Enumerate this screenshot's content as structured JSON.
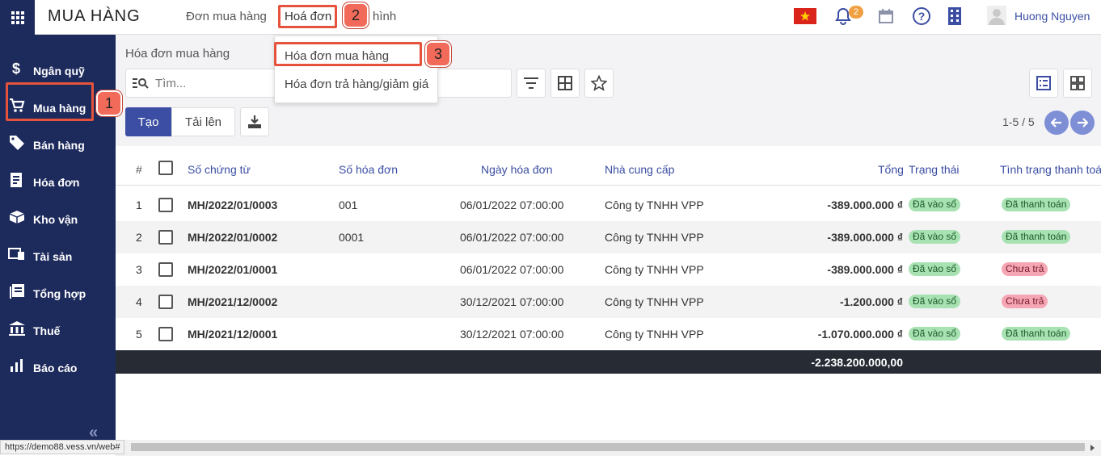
{
  "app": {
    "title": "MUA HÀNG"
  },
  "nav": {
    "purchase_orders": "Đơn mua hàng",
    "invoices": "Hoá đơn",
    "config": "hình"
  },
  "header": {
    "notification_count": "2",
    "user_name": "Huong Nguyen"
  },
  "sidebar": {
    "items": [
      {
        "label": "Ngân quỹ",
        "icon": "dollar-icon"
      },
      {
        "label": "Mua hàng",
        "icon": "cart-icon"
      },
      {
        "label": "Bán hàng",
        "icon": "tag-icon"
      },
      {
        "label": "Hóa đơn",
        "icon": "receipt-icon"
      },
      {
        "label": "Kho vận",
        "icon": "boxes-icon"
      },
      {
        "label": "Tài sản",
        "icon": "asset-icon"
      },
      {
        "label": "Tổng hợp",
        "icon": "book-icon"
      },
      {
        "label": "Thuế",
        "icon": "bank-icon"
      },
      {
        "label": "Báo cáo",
        "icon": "bar-chart-icon"
      }
    ],
    "collapse": "«"
  },
  "dropdown": {
    "items": [
      "Hóa đơn mua hàng",
      "Hóa đơn trả hàng/giảm giá"
    ]
  },
  "page": {
    "breadcrumb": "Hóa đơn mua hàng",
    "search_placeholder": "Tìm..."
  },
  "toolbar": {
    "create": "Tạo",
    "upload": "Tải lên",
    "pager": "1-5 / 5"
  },
  "table": {
    "columns": [
      "#",
      "Số chứng từ",
      "Số hóa đơn",
      "Ngày hóa đơn",
      "Nhà cung cấp",
      "Tổng",
      "Trạng thái",
      "Tình trạng thanh toán"
    ],
    "rows": [
      {
        "n": "1",
        "doc": "MH/2022/01/0003",
        "inv": "001",
        "date": "06/01/2022 07:00:00",
        "vendor": "Công ty TNHH VPP",
        "total": "-389.000.000 ₫",
        "status": "Đã vào sổ",
        "payment": "Đã thanh toán",
        "payment_color": "green"
      },
      {
        "n": "2",
        "doc": "MH/2022/01/0002",
        "inv": "0001",
        "date": "06/01/2022 07:00:00",
        "vendor": "Công ty TNHH VPP",
        "total": "-389.000.000 ₫",
        "status": "Đã vào sổ",
        "payment": "Đã thanh toán",
        "payment_color": "green"
      },
      {
        "n": "3",
        "doc": "MH/2022/01/0001",
        "inv": "",
        "date": "06/01/2022 07:00:00",
        "vendor": "Công ty TNHH VPP",
        "total": "-389.000.000 ₫",
        "status": "Đã vào sổ",
        "payment": "Chưa trả",
        "payment_color": "red"
      },
      {
        "n": "4",
        "doc": "MH/2021/12/0002",
        "inv": "",
        "date": "30/12/2021 07:00:00",
        "vendor": "Công ty TNHH VPP",
        "total": "-1.200.000 ₫",
        "status": "Đã vào sổ",
        "payment": "Chưa trả",
        "payment_color": "red"
      },
      {
        "n": "5",
        "doc": "MH/2021/12/0001",
        "inv": "",
        "date": "30/12/2021 07:00:00",
        "vendor": "Công ty TNHH VPP",
        "total": "-1.070.000.000 ₫",
        "status": "Đã vào sổ",
        "payment": "Đã thanh toán",
        "payment_color": "green"
      }
    ],
    "footer_total": "-2.238.200.000,00"
  },
  "steps": [
    "1",
    "2",
    "3"
  ],
  "status_url": "https://demo88.vess.vn/web#",
  "colors": {
    "sidebar": "#1d2a5c",
    "primary": "#3b4ea3",
    "highlight": "#e5533d",
    "badge_green": "#a8e2b3",
    "badge_red": "#f5a6b4"
  }
}
